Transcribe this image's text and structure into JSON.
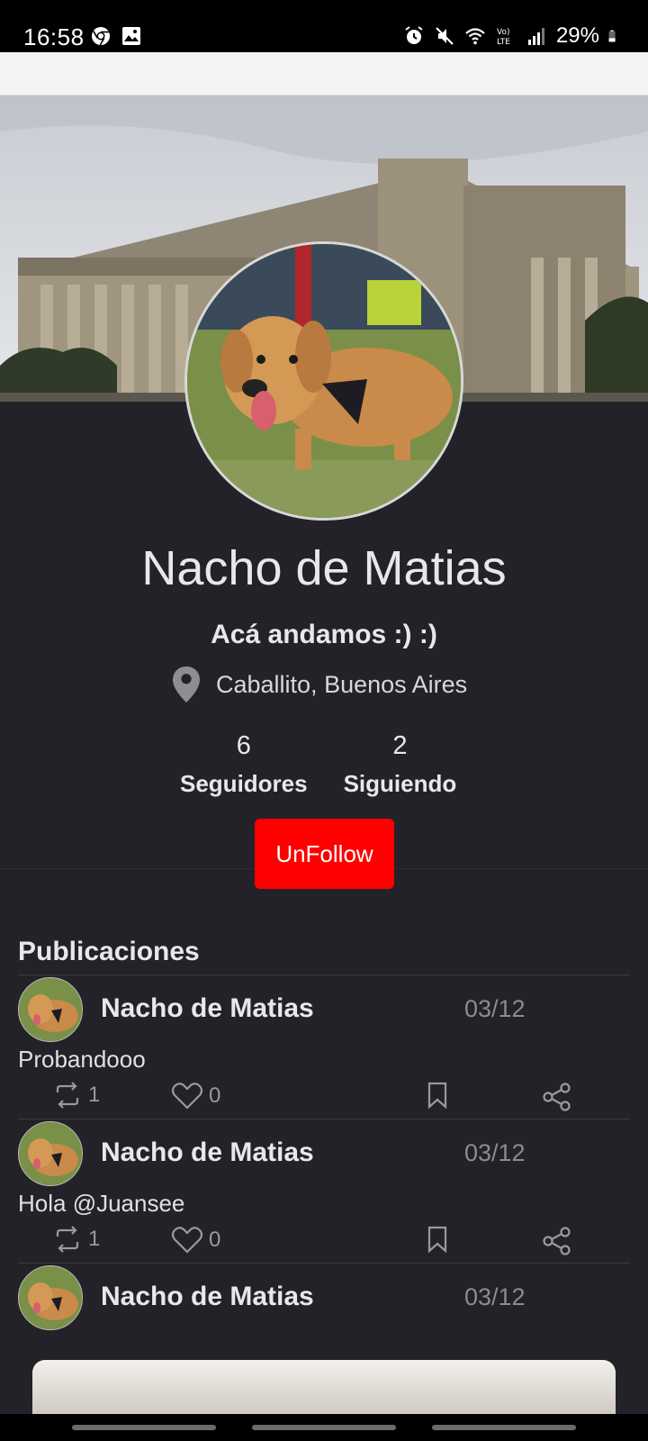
{
  "status_bar": {
    "time": "16:58",
    "battery": "29%",
    "icons_left": [
      "chrome-icon",
      "gallery-icon"
    ],
    "icons_right": [
      "alarm-icon",
      "mute-icon",
      "wifi-icon",
      "volte-icon",
      "signal-icon",
      "battery-icon"
    ]
  },
  "profile": {
    "name": "Nacho de Matias",
    "bio": "Acá andamos :) :)",
    "location": "Caballito, Buenos Aires",
    "followers_count": "6",
    "followers_label": "Seguidores",
    "following_count": "2",
    "following_label": "Siguiendo",
    "unfollow_label": "UnFollow"
  },
  "colors": {
    "background": "#232228",
    "unfollow": "#fe0000",
    "muted": "#8c8b92"
  },
  "posts_section": {
    "title": "Publicaciones",
    "posts": [
      {
        "author": "Nacho de Matias",
        "date": "03/12",
        "text": "Probandooo",
        "retweets": "1",
        "likes": "0"
      },
      {
        "author": "Nacho de Matias",
        "date": "03/12",
        "text": "Hola @Juansee",
        "retweets": "1",
        "likes": "0"
      },
      {
        "author": "Nacho de Matias",
        "date": "03/12",
        "text": "",
        "retweets": "",
        "likes": ""
      }
    ]
  }
}
